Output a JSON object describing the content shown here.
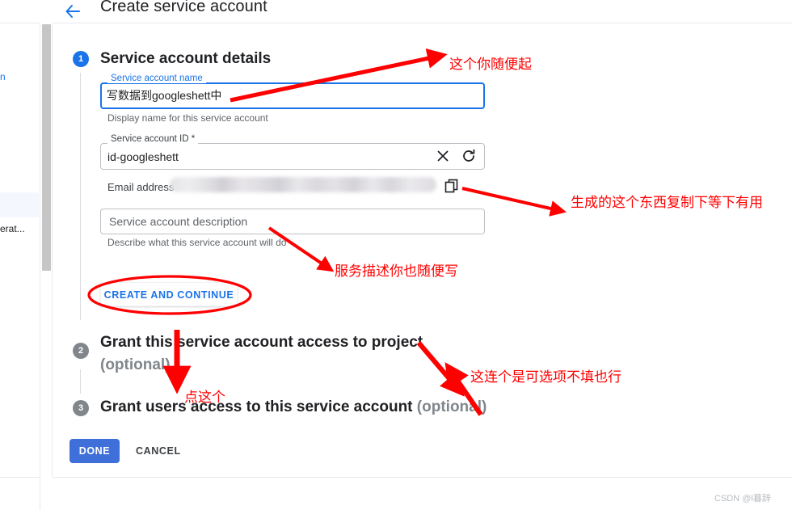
{
  "header": {
    "back_icon": "arrow-left-icon",
    "title": "Create service account"
  },
  "left_sidebar": {
    "snippet_blue": "n",
    "snippet_dark": "erat..."
  },
  "steps": [
    {
      "number": "1",
      "title": "Service account details",
      "optional": ""
    },
    {
      "number": "2",
      "title": "Grant this service account access to project",
      "optional": "(optional)"
    },
    {
      "number": "3",
      "title": "Grant users access to this service account",
      "optional": "(optional)"
    }
  ],
  "form": {
    "name_field": {
      "label": "Service account name",
      "value": "写数据到googleshett中",
      "helper": "Display name for this service account"
    },
    "id_field": {
      "label": "Service account ID *",
      "value": "id-googleshett",
      "clear_icon": "close-icon",
      "refresh_icon": "refresh-icon"
    },
    "email_row": {
      "label": "Email address",
      "value": "",
      "copy_icon": "copy-icon"
    },
    "description_field": {
      "placeholder": "Service account description",
      "helper": "Describe what this service account will do"
    }
  },
  "buttons": {
    "create_and_continue": "CREATE AND CONTINUE",
    "done": "DONE",
    "cancel": "CANCEL"
  },
  "annotations": [
    {
      "id": "name-note",
      "text": "这个你随便起"
    },
    {
      "id": "email-note",
      "text": "生成的这个东西复制下等下有用"
    },
    {
      "id": "desc-note",
      "text": "服务描述你也随便写"
    },
    {
      "id": "optional-note",
      "text": "这连个是可选项不填也行"
    },
    {
      "id": "click-note",
      "text": "点这个"
    }
  ],
  "watermark": "CSDN @l暮辞",
  "colors": {
    "accent_blue": "#1a73e8",
    "annotation_red": "#ff0000",
    "step_inactive": "#80868b",
    "done_button": "#3f6fd8"
  }
}
